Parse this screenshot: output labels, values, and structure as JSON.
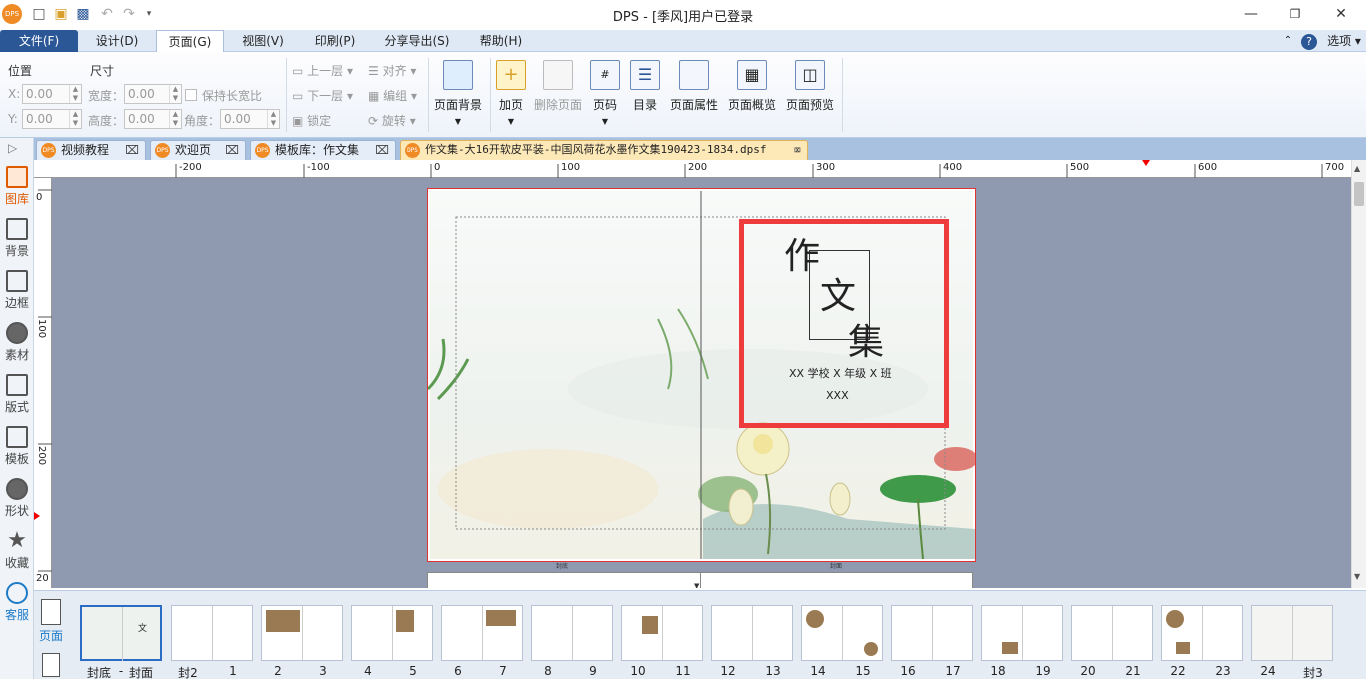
{
  "titlebar": {
    "title": "DPS - [季风]用户已登录",
    "logo": "DPS"
  },
  "menu": {
    "file": "文件(F)",
    "design": "设计(D)",
    "page": "页面(G)",
    "view": "视图(V)",
    "print": "印刷(P)",
    "share": "分享导出(S)",
    "help": "帮助(H)",
    "options": "选项"
  },
  "ribbon": {
    "position": "位置",
    "size": "尺寸",
    "x_label": "X:",
    "y_label": "Y:",
    "x_value": "0.00",
    "y_value": "0.00",
    "width_label": "宽度：",
    "height_label": "高度：",
    "width_value": "0.00",
    "height_value": "0.00",
    "keep_ratio": "保持长宽比",
    "angle_label": "角度：",
    "angle_value": "0.00",
    "up_layer": "上一层",
    "down_layer": "下一层",
    "lock": "锁定",
    "align": "对齐",
    "group": "编组",
    "rotate": "旋转",
    "page_bg": "页面背景",
    "add_page": "加页",
    "delete_page": "删除页面",
    "page_num": "页码",
    "toc": "目录",
    "page_props": "页面属性",
    "page_overview": "页面概览",
    "page_preview": "页面预览"
  },
  "tabs": [
    {
      "label": "视频教程"
    },
    {
      "label": "欢迎页"
    },
    {
      "label": "模板库：作文集"
    },
    {
      "label": "作文集-大16开软皮平装-中国风荷花水墨作文集190423-1834.dpsf"
    }
  ],
  "tab_icon": "DPS",
  "sidebar": [
    {
      "label": "图库",
      "icon": "gallery-icon"
    },
    {
      "label": "背景",
      "icon": "background-icon"
    },
    {
      "label": "边框",
      "icon": "border-icon"
    },
    {
      "label": "素材",
      "icon": "material-icon"
    },
    {
      "label": "版式",
      "icon": "layout-icon"
    },
    {
      "label": "模板",
      "icon": "template-icon"
    },
    {
      "label": "形状",
      "icon": "shape-icon"
    },
    {
      "label": "收藏",
      "icon": "star-icon"
    },
    {
      "label": "客服",
      "icon": "chat-icon"
    }
  ],
  "ruler_h": [
    "-200",
    "-100",
    "0",
    "100",
    "200",
    "300",
    "400",
    "500",
    "600",
    "700"
  ],
  "ruler_v": [
    "0",
    "100",
    "200",
    "20"
  ],
  "cover": {
    "title1": "作",
    "title2": "文",
    "title3": "集",
    "school": "XX 学校 X 年级 X 班",
    "name": "XXX",
    "back_label": "封底",
    "front_label": "封面"
  },
  "bottom": {
    "pages_label": "页面"
  },
  "thumbnails": [
    {
      "labels": [
        "封底",
        "-",
        "封面"
      ]
    },
    {
      "labels": [
        "封2",
        "1"
      ]
    },
    {
      "labels": [
        "2",
        "3"
      ]
    },
    {
      "labels": [
        "4",
        "5"
      ]
    },
    {
      "labels": [
        "6",
        "7"
      ]
    },
    {
      "labels": [
        "8",
        "9"
      ]
    },
    {
      "labels": [
        "10",
        "11"
      ]
    },
    {
      "labels": [
        "12",
        "13"
      ]
    },
    {
      "labels": [
        "14",
        "15"
      ]
    },
    {
      "labels": [
        "16",
        "17"
      ]
    },
    {
      "labels": [
        "18",
        "19"
      ]
    },
    {
      "labels": [
        "20",
        "21"
      ]
    },
    {
      "labels": [
        "22",
        "23"
      ]
    },
    {
      "labels": [
        "24",
        "封3"
      ]
    }
  ],
  "colors": {
    "file_tab": "#2b5797",
    "highlight_box": "#ee3b3b",
    "canvas_bg": "#8f9ab1",
    "active_doc_tab": "#fde9b8"
  }
}
